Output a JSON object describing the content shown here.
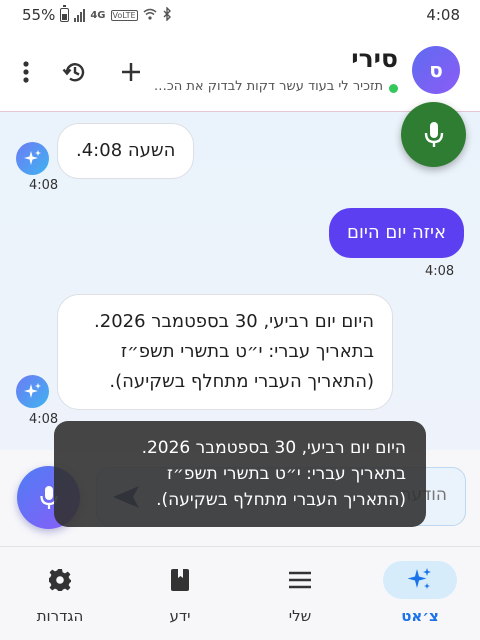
{
  "status_bar": {
    "battery": "55%",
    "network": "4G",
    "volte": "VoLTE",
    "time": "4:08"
  },
  "header": {
    "avatar_letter": "ס",
    "assistant_name": "סירי",
    "assistant_status": "תזכיר לי בעוד עשר דקות לבדוק את הכביסה"
  },
  "messages": [
    {
      "role": "bot",
      "text": "השעה 4:08.",
      "time": "4:08"
    },
    {
      "role": "user",
      "text": "איזה יום היום",
      "time": "4:08"
    },
    {
      "role": "bot",
      "lines": [
        "היום יום רביעי, 30 בספטמבר 2026.",
        "בתאריך עברי: י״ט בתשרי תשפ״ז",
        "(התאריך העברי מתחלף בשקיעה)."
      ],
      "time": "4:08"
    }
  ],
  "composer": {
    "placeholder": "הודעה"
  },
  "toast": {
    "lines": [
      "היום יום רביעי, 30 בספטמבר 2026.",
      "בתאריך עברי: י״ט בתשרי תשפ״ז",
      "(התאריך העברי מתחלף בשקיעה)."
    ]
  },
  "nav": {
    "items": [
      {
        "label": "צ׳אט",
        "icon": "sparkle-icon",
        "active": true
      },
      {
        "label": "שלי",
        "icon": "menu-icon",
        "active": false
      },
      {
        "label": "ידע",
        "icon": "book-icon",
        "active": false
      },
      {
        "label": "הגדרות",
        "icon": "gear-icon",
        "active": false
      }
    ]
  },
  "colors": {
    "accent": "#5b3ff0",
    "mic_green": "#2e7d32",
    "nav_active": "#1a73e8",
    "online": "#34c759"
  }
}
